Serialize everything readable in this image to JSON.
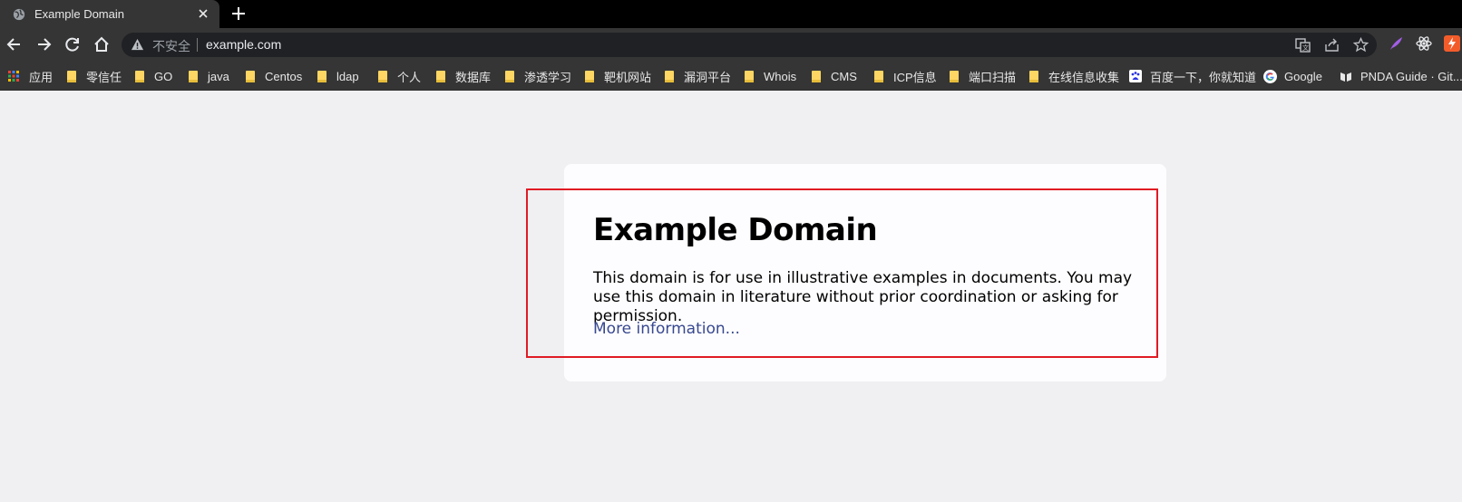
{
  "tab": {
    "title": "Example Domain"
  },
  "omnibox": {
    "security_label": "不安全",
    "url": "example.com"
  },
  "bookmarks": [
    {
      "label": "应用",
      "icon": "apps-grid-icon"
    },
    {
      "label": "零信任",
      "icon": "folder-icon"
    },
    {
      "label": "GO",
      "icon": "folder-icon"
    },
    {
      "label": "java",
      "icon": "folder-icon"
    },
    {
      "label": "Centos",
      "icon": "folder-icon"
    },
    {
      "label": "ldap",
      "icon": "folder-icon"
    },
    {
      "label": "个人",
      "icon": "folder-icon"
    },
    {
      "label": "数据库",
      "icon": "folder-icon"
    },
    {
      "label": "渗透学习",
      "icon": "folder-icon"
    },
    {
      "label": "靶机网站",
      "icon": "folder-icon"
    },
    {
      "label": "漏洞平台",
      "icon": "folder-icon"
    },
    {
      "label": "Whois",
      "icon": "folder-icon"
    },
    {
      "label": "CMS",
      "icon": "folder-icon"
    },
    {
      "label": "ICP信息",
      "icon": "folder-icon"
    },
    {
      "label": "端口扫描",
      "icon": "folder-icon"
    },
    {
      "label": "在线信息收集",
      "icon": "folder-icon"
    },
    {
      "label": "百度一下，你就知道",
      "icon": "baidu-icon"
    },
    {
      "label": "Google",
      "icon": "google-icon"
    },
    {
      "label": "PNDA Guide · Git...",
      "icon": "gitbook-icon"
    }
  ],
  "page": {
    "heading": "Example Domain",
    "body": "This domain is for use in illustrative examples in documents. You may use this domain in literature without prior coordination or asking for permission.",
    "link": "More information..."
  },
  "colors": {
    "highlight_border": "#e01b24",
    "link": "#38488f",
    "page_background": "#f0f0f2",
    "folder": "#fdd663"
  }
}
